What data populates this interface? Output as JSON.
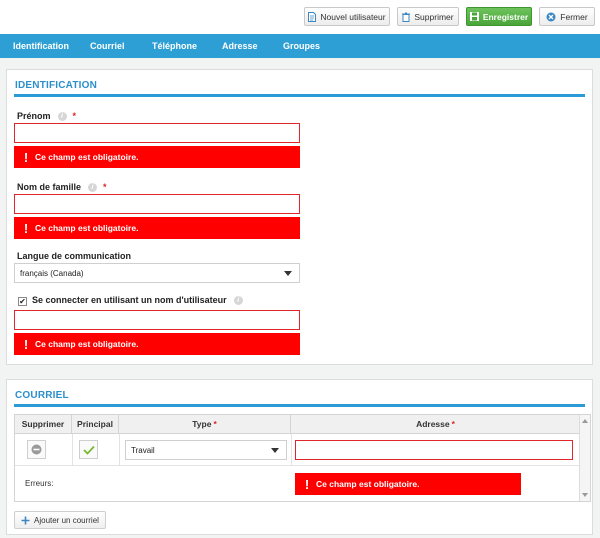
{
  "toolbar": {
    "new_user": "Nouvel utilisateur",
    "delete": "Supprimer",
    "save": "Enregistrer",
    "close": "Fermer"
  },
  "nav": {
    "items": [
      "Identification",
      "Courriel",
      "Téléphone",
      "Adresse",
      "Groupes"
    ]
  },
  "identification": {
    "title": "IDENTIFICATION",
    "first_name": {
      "label": "Prénom",
      "required_mark": "*",
      "value": "",
      "error": "Ce champ est obligatoire."
    },
    "last_name": {
      "label": "Nom de famille",
      "required_mark": "*",
      "value": "",
      "error": "Ce champ est obligatoire."
    },
    "language": {
      "label": "Langue de communication",
      "selected": "français (Canada)"
    },
    "username": {
      "label": "Se connecter en utilisant un nom d'utilisateur",
      "checked": true,
      "value": "",
      "error": "Ce champ est obligatoire."
    },
    "info_glyph": "i",
    "error_glyph": "!"
  },
  "email": {
    "title": "COURRIEL",
    "columns": {
      "delete": "Supprimer",
      "principal": "Principal",
      "type": "Type",
      "address": "Adresse",
      "required_mark": "*"
    },
    "row": {
      "type_selected": "Travail",
      "address_value": "",
      "principal": true
    },
    "errors_label": "Erreurs:",
    "error": "Ce champ est obligatoire.",
    "add_button": "Ajouter un courriel"
  },
  "colors": {
    "accent": "#2e9fd5",
    "error": "#ff0000",
    "save_green": "#4aa539"
  }
}
